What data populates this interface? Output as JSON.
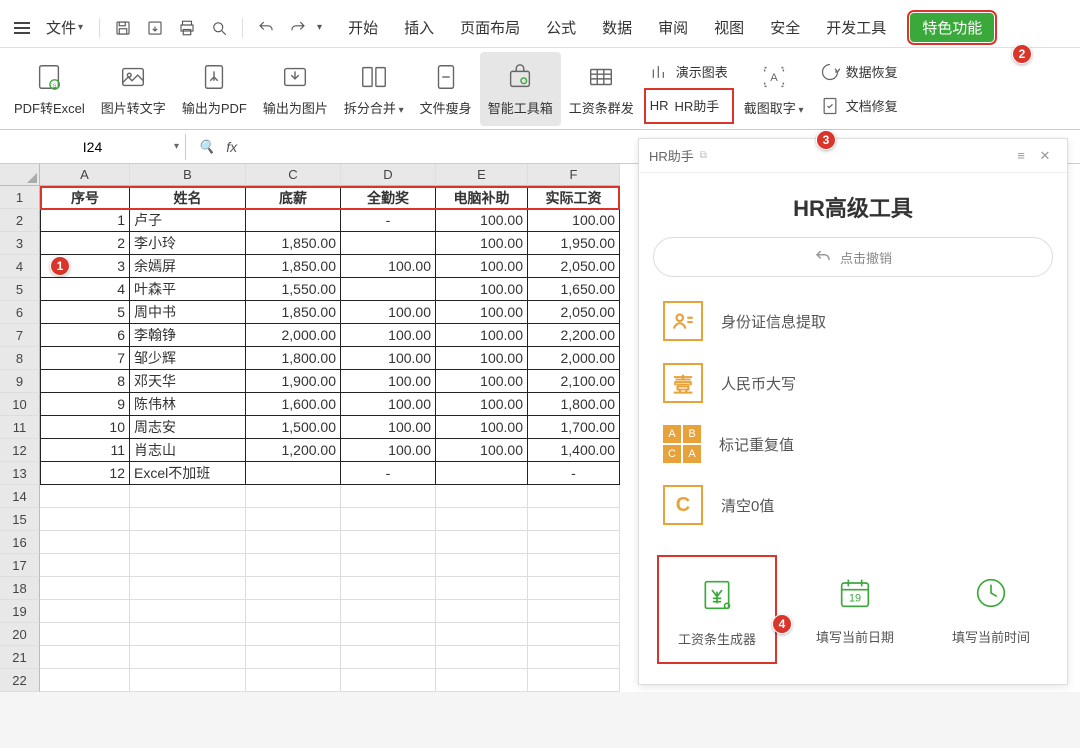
{
  "menu": {
    "file": "文件",
    "tabs": [
      "开始",
      "插入",
      "页面布局",
      "公式",
      "数据",
      "审阅",
      "视图",
      "安全",
      "开发工具"
    ],
    "special": "特色功能"
  },
  "ribbon": {
    "pdf2excel": "PDF转Excel",
    "img2text": "图片转文字",
    "exportpdf": "输出为PDF",
    "exportimg": "输出为图片",
    "splitmerge": "拆分合并",
    "slim": "文件瘦身",
    "smarttool": "智能工具箱",
    "payslip": "工资条群发",
    "presentchart": "演示图表",
    "hr": "HR助手",
    "screenshot": "截图取字",
    "recover": "数据恢复",
    "docfix": "文档修复"
  },
  "namebox": "I24",
  "columns": [
    "A",
    "B",
    "C",
    "D",
    "E",
    "F"
  ],
  "headers": [
    "序号",
    "姓名",
    "底薪",
    "全勤奖",
    "电脑补助",
    "实际工资"
  ],
  "rows": [
    [
      "1",
      "卢子",
      "",
      "-",
      "100.00",
      "100.00"
    ],
    [
      "2",
      "李小玲",
      "1,850.00",
      "",
      "100.00",
      "1,950.00"
    ],
    [
      "3",
      "余嫣屏",
      "1,850.00",
      "100.00",
      "100.00",
      "2,050.00"
    ],
    [
      "4",
      "叶森平",
      "1,550.00",
      "",
      "100.00",
      "1,650.00"
    ],
    [
      "5",
      "周中书",
      "1,850.00",
      "100.00",
      "100.00",
      "2,050.00"
    ],
    [
      "6",
      "李翰铮",
      "2,000.00",
      "100.00",
      "100.00",
      "2,200.00"
    ],
    [
      "7",
      "邹少辉",
      "1,800.00",
      "100.00",
      "100.00",
      "2,000.00"
    ],
    [
      "8",
      "邓天华",
      "1,900.00",
      "100.00",
      "100.00",
      "2,100.00"
    ],
    [
      "9",
      "陈伟林",
      "1,600.00",
      "100.00",
      "100.00",
      "1,800.00"
    ],
    [
      "10",
      "周志安",
      "1,500.00",
      "100.00",
      "100.00",
      "1,700.00"
    ],
    [
      "11",
      "肖志山",
      "1,200.00",
      "100.00",
      "100.00",
      "1,400.00"
    ],
    [
      "12",
      "Excel不加班",
      "",
      "-",
      "",
      "-"
    ]
  ],
  "hrpanel": {
    "wintitle": "HR助手",
    "title": "HR高级工具",
    "undo": "点击撤销",
    "items": [
      "身份证信息提取",
      "人民币大写",
      "标记重复值",
      "清空0值"
    ],
    "yi": "壹",
    "c": "C",
    "cards": {
      "payslip": "工资条生成器",
      "today": "填写当前日期",
      "now": "填写当前时间",
      "daynum": "19"
    }
  },
  "badges": {
    "b1": "1",
    "b2": "2",
    "b3": "3",
    "b4": "4"
  },
  "aligns": [
    [
      "num",
      "txt",
      "num",
      "center",
      "num",
      "num"
    ],
    [
      "num",
      "txt",
      "num",
      "num",
      "num",
      "num"
    ],
    [
      "num",
      "txt",
      "num",
      "num",
      "num",
      "num"
    ],
    [
      "num",
      "txt",
      "num",
      "num",
      "num",
      "num"
    ],
    [
      "num",
      "txt",
      "num",
      "num",
      "num",
      "num"
    ],
    [
      "num",
      "txt",
      "num",
      "num",
      "num",
      "num"
    ],
    [
      "num",
      "txt",
      "num",
      "num",
      "num",
      "num"
    ],
    [
      "num",
      "txt",
      "num",
      "num",
      "num",
      "num"
    ],
    [
      "num",
      "txt",
      "num",
      "num",
      "num",
      "num"
    ],
    [
      "num",
      "txt",
      "num",
      "num",
      "num",
      "num"
    ],
    [
      "num",
      "txt",
      "num",
      "num",
      "num",
      "num"
    ],
    [
      "num",
      "txt",
      "num",
      "center",
      "num",
      "center"
    ]
  ]
}
